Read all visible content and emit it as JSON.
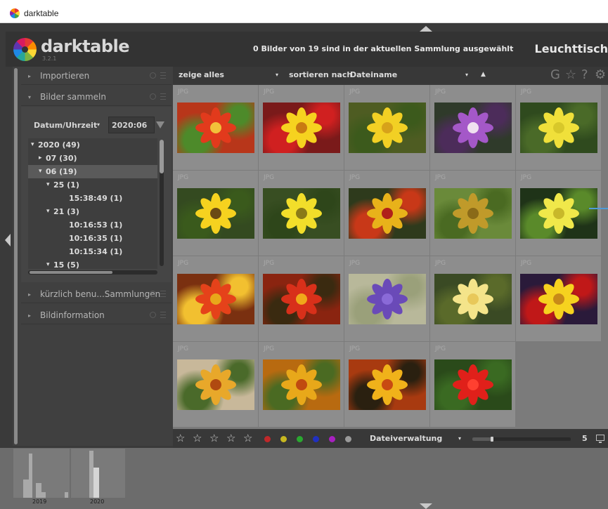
{
  "window": {
    "title": "darktable"
  },
  "header": {
    "logo_text": "darktable",
    "version": "3.2.1",
    "status": "0 Bilder von 19 sind in der aktuellen Sammlung ausgewählt",
    "view": "Leuchttisch"
  },
  "left_panel": {
    "modules": [
      {
        "label": "Importieren",
        "expanded": false
      },
      {
        "label": "Bilder sammeln",
        "expanded": true
      },
      {
        "label": "kürzlich benu...Sammlungen",
        "expanded": false
      },
      {
        "label": "Bildinformation",
        "expanded": false
      }
    ],
    "collect": {
      "property": "Datum/Uhrzeit",
      "value": "2020:06",
      "tree": [
        {
          "label": "2020 (49)",
          "expander": "▾",
          "selected": false
        },
        {
          "label": "07 (30)",
          "expander": "▸",
          "selected": false
        },
        {
          "label": "06 (19)",
          "expander": "▾",
          "selected": true
        },
        {
          "label": "25 (1)",
          "expander": "▾",
          "selected": false
        },
        {
          "label": "15:38:49 (1)",
          "expander": "",
          "selected": false
        },
        {
          "label": "21 (3)",
          "expander": "▾",
          "selected": false
        },
        {
          "label": "10:16:53 (1)",
          "expander": "",
          "selected": false
        },
        {
          "label": "10:16:35 (1)",
          "expander": "",
          "selected": false
        },
        {
          "label": "10:15:34 (1)",
          "expander": "",
          "selected": false
        },
        {
          "label": "15 (5)",
          "expander": "▾",
          "selected": false
        }
      ]
    }
  },
  "toolbar": {
    "show_label": "zeige",
    "show_value": "alles",
    "sort_label": "sortieren nach",
    "sort_value": "Dateiname",
    "sort_dir_icon": "▲",
    "right_icons": [
      "G",
      "☆",
      "?",
      "⚙"
    ]
  },
  "grid": {
    "format_label": "JPG",
    "thumbnails": [
      {
        "name": "red-flower",
        "bg": "#b8361a",
        "petal": "#e23a1c",
        "center": "#f2c23a",
        "accent": "#4d8a2a"
      },
      {
        "name": "yellow-red-flowers",
        "bg": "#7a1a1a",
        "petal": "#f6d21f",
        "center": "#c97a12",
        "accent": "#d02020"
      },
      {
        "name": "yellow-flower-green",
        "bg": "#4e5c22",
        "petal": "#f2d024",
        "center": "#d7a21a",
        "accent": "#3c5a1c"
      },
      {
        "name": "purple-foxglove",
        "bg": "#2f3a2a",
        "petal": "#a458c8",
        "center": "#f0e0f0",
        "accent": "#4c2c5a"
      },
      {
        "name": "yellow-yarrow",
        "bg": "#2f4a1e",
        "petal": "#f0e03a",
        "center": "#d8c82a",
        "accent": "#4a6a28"
      },
      {
        "name": "yellow-daisy",
        "bg": "#344a20",
        "petal": "#f6d21f",
        "center": "#6a4a14",
        "accent": "#3a5a1c"
      },
      {
        "name": "yellow-cosmos",
        "bg": "#384e22",
        "petal": "#f2de2a",
        "center": "#8a7a18",
        "accent": "#2e461a"
      },
      {
        "name": "red-yellow-gaillardia",
        "bg": "#2e3a1c",
        "petal": "#e8b21a",
        "center": "#b0201a",
        "accent": "#c83818"
      },
      {
        "name": "green-bud",
        "bg": "#6a8a3a",
        "petal": "#c09a2a",
        "center": "#8a6a18",
        "accent": "#4a6a22"
      },
      {
        "name": "yellow-flower-cluster",
        "bg": "#1f3318",
        "petal": "#f0e84a",
        "center": "#c8b82a",
        "accent": "#5a8a2a"
      },
      {
        "name": "red-coreopsis",
        "bg": "#7a3010",
        "petal": "#e5421a",
        "center": "#e8a81a",
        "accent": "#f2c030"
      },
      {
        "name": "bee-on-red-flower",
        "bg": "#8a2410",
        "petal": "#d8301a",
        "center": "#f0a81a",
        "accent": "#3a2a10"
      },
      {
        "name": "purple-lavender",
        "bg": "#b8b89a",
        "petal": "#6a4ab8",
        "center": "#8a6ad8",
        "accent": "#9aa07a"
      },
      {
        "name": "yellow-achillea",
        "bg": "#3a4a24",
        "petal": "#f4e48a",
        "center": "#e8c85a",
        "accent": "#5a6a2a"
      },
      {
        "name": "yellow-red-flowers-2",
        "bg": "#2a1a3a",
        "petal": "#f6d21f",
        "center": "#c88a18",
        "accent": "#c01818"
      },
      {
        "name": "bud-orange",
        "bg": "#c8b89a",
        "petal": "#e8a82a",
        "center": "#b04a10",
        "accent": "#4a6a2a"
      },
      {
        "name": "bud-orange-2",
        "bg": "#b86a10",
        "petal": "#e8a81a",
        "center": "#c04a10",
        "accent": "#4a6a22"
      },
      {
        "name": "bee-on-orange-flower",
        "bg": "#a83a10",
        "petal": "#f0b21a",
        "center": "#c84a12",
        "accent": "#2a2010"
      },
      {
        "name": "red-salvia",
        "bg": "#2a4a1a",
        "petal": "#e0201a",
        "center": "#ff4030",
        "accent": "#3a6a22"
      }
    ]
  },
  "bottom_bar": {
    "stars": [
      "☆",
      "☆",
      "☆",
      "☆",
      "☆"
    ],
    "color_labels": [
      "#c0282a",
      "#c8b820",
      "#2aa830",
      "#2030c0",
      "#a820c0",
      "#9a9a9a"
    ],
    "mode_label": "Dateiverwaltung",
    "zoom_fraction": 0.2,
    "zoom_value": "5"
  },
  "timeline": {
    "years": [
      "2019",
      "2020"
    ]
  }
}
